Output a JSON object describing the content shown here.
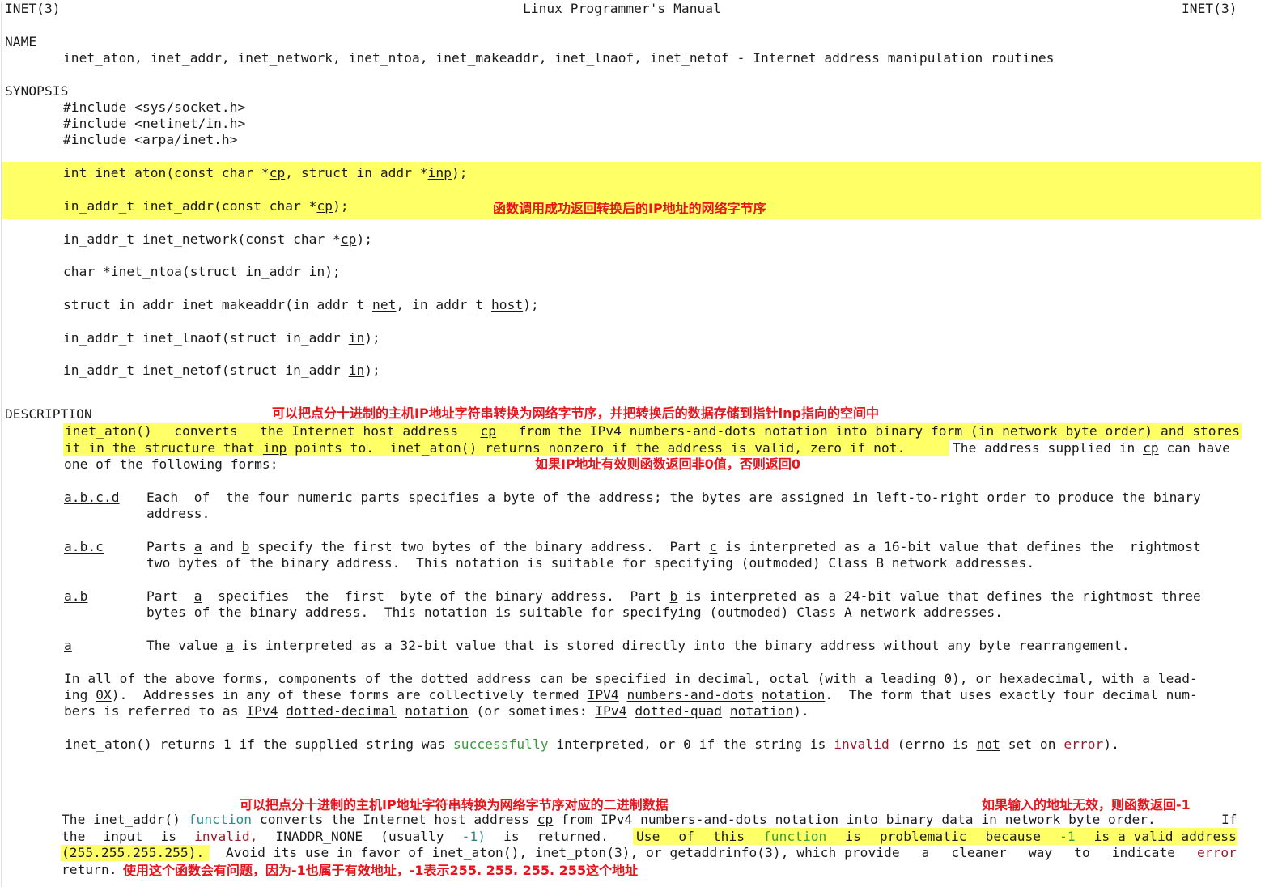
{
  "header": {
    "left": "INET(3)",
    "center": "Linux Programmer's Manual",
    "right": "INET(3)"
  },
  "name_section": {
    "heading": "NAME",
    "text": "inet_aton, inet_addr, inet_network, inet_ntoa, inet_makeaddr, inet_lnaof, inet_netof - Internet address manipulation routines"
  },
  "synopsis": {
    "heading": "SYNOPSIS",
    "includes": [
      "#include <sys/socket.h>",
      "#include <netinet/in.h>",
      "#include <arpa/inet.h>"
    ],
    "prototypes": [
      {
        "pre": "int inet_aton(const char *",
        "a1": "cp",
        "mid": ", struct in_addr *",
        "a2": "inp",
        "post": ");"
      },
      {
        "pre": "in_addr_t inet_addr(const char *",
        "a1": "cp",
        "post": ");"
      },
      {
        "pre": "in_addr_t inet_network(const char *",
        "a1": "cp",
        "post": ");"
      },
      {
        "pre": "char *inet_ntoa(struct in_addr ",
        "a1": "in",
        "post": ");"
      },
      {
        "pre": "struct in_addr inet_makeaddr(in_addr_t ",
        "a1": "net",
        "mid": ", in_addr_t ",
        "a2": "host",
        "post": ");"
      },
      {
        "pre": "in_addr_t inet_lnaof(struct in_addr ",
        "a1": "in",
        "post": ");"
      },
      {
        "pre": "in_addr_t inet_netof(struct in_addr ",
        "a1": "in",
        "post": ");"
      }
    ]
  },
  "description": {
    "heading": "DESCRIPTION",
    "para1": {
      "l1": [
        "inet_aton()",
        "converts",
        "the Internet host address",
        "cp",
        "from the IPv4 numbers-and-dots notation into binary form (in network byte order) and stores"
      ],
      "l2a": "it in the structure that ",
      "l2_inp": "inp",
      "l2b": " points to.  inet_aton() returns nonzero if the address is valid, zero if not.",
      "l2c": "The address supplied in ",
      "l2_cp": "cp",
      "l2d": " can have",
      "l3": "one of the following forms:"
    },
    "forms": [
      {
        "label": "a.b.c.d",
        "l1": "Each  of  the four numeric parts specifies a byte of the address; the bytes are assigned in left-to-right order to produce the binary",
        "l2": "address."
      },
      {
        "label": "a.b.c",
        "l1a": "Parts ",
        "v1": "a",
        "l1b": " and ",
        "v2": "b",
        "l1c": " specify the first two bytes of the binary address.  Part ",
        "v3": "c",
        "l1d": " is interpreted as a 16-bit value that defines the  rightmost",
        "l2": "two bytes of the binary address.  This notation is suitable for specifying (outmoded) Class B network addresses."
      },
      {
        "label": "a.b",
        "l1a": "Part  ",
        "v1": "a",
        "l1b": "  specifies  the  first  byte of the binary address.  Part ",
        "v2": "b",
        "l1c": " is interpreted as a 24-bit value that defines the rightmost three",
        "l2": "bytes of the binary address.  This notation is suitable for specifying (outmoded) Class A network addresses."
      },
      {
        "label": "a",
        "l1a": "The value ",
        "v1": "a",
        "l1b": " is interpreted as a 32-bit value that is stored directly into the binary address without any byte rearrangement."
      }
    ],
    "para2": {
      "l1a": "In all of the above forms, components of the dotted address can be specified in decimal, octal (with a leading ",
      "l1_0": "0",
      "l1b": "), or hexadecimal, with a lead-",
      "l2a": "ing ",
      "l2_0x": "0X",
      "l2b": ").  Addresses in any of these forms are collectively termed ",
      "l2_ipv4": "IPV4",
      "l2_nad": "numbers-and-dots",
      "l2_not": "notation",
      "l2c": ".  The form that uses exactly four decimal num-",
      "l3a": "bers is referred to as ",
      "l3_ipv4": "IPv4",
      "l3_dd": "dotted-decimal",
      "l3_not": "notation",
      "l3b": " (or sometimes: ",
      "l3_ipv4b": "IPv4",
      "l3_dq": "dotted-quad",
      "l3_not2": "notation",
      "l3c": ")."
    },
    "para3": {
      "a": "inet_aton() returns 1 if the supplied string was ",
      "successfully": "successfully",
      "b": " interpreted, or 0 if the string is ",
      "invalid": "invalid",
      "c": " (errno is ",
      "not": "not",
      "d": " set on ",
      "error": "error",
      "e": ")."
    },
    "para4": {
      "l1a": "The inet_addr() ",
      "function": "function",
      "l1b": " converts the Internet host address ",
      "cp": "cp",
      "l1c": " from IPv4 numbers-and-dots notation into binary data in network byte order.",
      "l1d": "If",
      "l2": [
        "the",
        "input",
        "is",
        "invalid,",
        "INADDR_NONE",
        "(usually",
        "-1)",
        "is",
        "returned."
      ],
      "l2hl": [
        "Use",
        "of",
        "this",
        "function",
        "is",
        "problematic",
        "because",
        "-1",
        "is a valid address"
      ],
      "l3a": "(255.255.255.255).",
      "l3b": [
        "Avoid its use in favor of inet_aton(), inet_pton(3), or getaddrinfo(3), which provide",
        "a",
        "cleaner",
        "way",
        "to",
        "indicate",
        "error"
      ],
      "l4": "return."
    }
  },
  "annotations": {
    "a1": "函数调用成功返回转换后的IP地址的网络字节序",
    "a2": "可以把点分十进制的主机IP地址字符串转换为网络字节序，并把转换后的数据存储到指针inp指向的空间中",
    "a3": "如果IP地址有效则函数返回非0值，否则返回0",
    "a4": "可以把点分十进制的主机IP地址字符串转换为网络字节序对应的二进制数据",
    "a5": "如果输入的地址无效，则函数返回-1",
    "a6": "使用这个函数会有问题，因为-1也属于有效地址，-1表示255. 255. 255. 255这个地址"
  },
  "colors": {
    "highlight": "#ffff66",
    "annotation": "#e8141c",
    "success": "#3a9a3a",
    "keyword": "#2a8a8a",
    "error": "#9a1a2a"
  }
}
